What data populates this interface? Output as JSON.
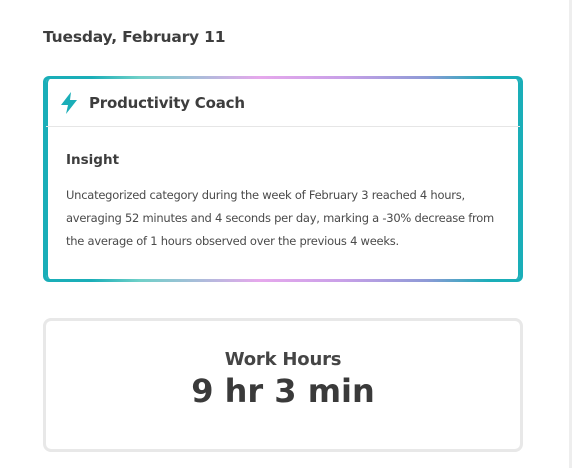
{
  "date_heading": "Tuesday, February 11",
  "coach": {
    "icon": "lightning-bolt-icon",
    "title": "Productivity Coach",
    "accent_color": "#1aaeb8",
    "insight": {
      "heading": "Insight",
      "text": "Uncategorized category during the week of February 3 reached 4 hours, averaging 52 minutes and 4 seconds per day, marking a -30% decrease from the average of 1 hours observed over the previous 4 weeks."
    }
  },
  "work_hours": {
    "label": "Work Hours",
    "value": "9 hr 3 min"
  }
}
